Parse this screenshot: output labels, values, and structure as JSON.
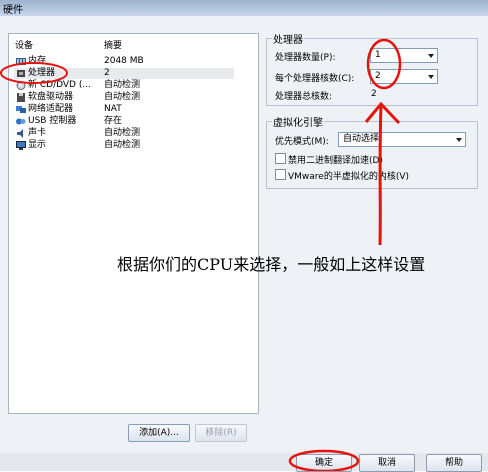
{
  "window": {
    "title": "硬件"
  },
  "device_list": {
    "col_device": "设备",
    "col_summary": "摘要",
    "items": [
      {
        "name": "内存",
        "summary": "2048 MB",
        "icon": "memory-icon"
      },
      {
        "name": "处理器",
        "summary": "2",
        "icon": "cpu-icon"
      },
      {
        "name": "新 CD/DVD (...",
        "summary": "自动检测",
        "icon": "cdrom-icon"
      },
      {
        "name": "软盘驱动器",
        "summary": "自动检测",
        "icon": "floppy-icon"
      },
      {
        "name": "网络适配器",
        "summary": "NAT",
        "icon": "network-icon"
      },
      {
        "name": "USB 控制器",
        "summary": "存在",
        "icon": "usb-icon"
      },
      {
        "name": "声卡",
        "summary": "自动检测",
        "icon": "sound-icon"
      },
      {
        "name": "显示",
        "summary": "自动检测",
        "icon": "display-icon"
      }
    ],
    "add_button": "添加(A)...",
    "remove_button": "移除(R)"
  },
  "processor": {
    "group_title": "处理器",
    "count_label": "处理器数量(P):",
    "count_value": "1",
    "cores_label": "每个处理器核数(C):",
    "cores_value": "2",
    "total_label": "处理器总核数:",
    "total_value": "2"
  },
  "virtualization": {
    "group_title": "虚拟化引擎",
    "mode_label": "优先模式(M):",
    "mode_value": "自动选择",
    "option1_label": "禁用二进制翻译加速(D)",
    "option2_label": "VMware的半虚拟化的内核(V)"
  },
  "annotation": {
    "text": "根据你们的CPU来选择，一般如上这样设置"
  },
  "footer": {
    "ok": "确定",
    "cancel": "取消",
    "help": "帮助"
  },
  "colors": {
    "annotation_red": "#e8120c",
    "title_bar": "#b4c7e0"
  }
}
